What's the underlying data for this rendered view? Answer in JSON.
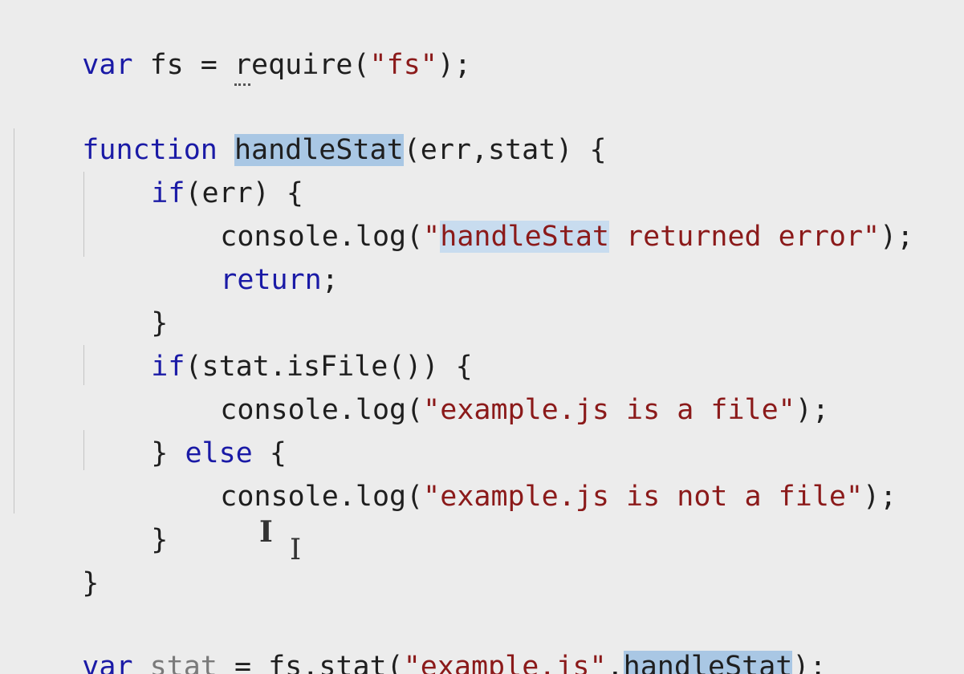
{
  "code": {
    "l1": {
      "kw": "var",
      "a": " fs = ",
      "req": "require",
      "b": "(",
      "s": "\"fs\"",
      "c": ");"
    },
    "l3": {
      "kw": "function",
      "sp": " ",
      "name": "handleStat",
      "rest": "(err,stat) {"
    },
    "l4": {
      "kw": "if",
      "rest": "(err) {"
    },
    "l5": {
      "a": "console.log(",
      "q": "\"",
      "hl": "handleStat",
      "s": " returned error\"",
      "c": ");"
    },
    "l6": {
      "kw": "return",
      "c": ";"
    },
    "l7": {
      "a": "}"
    },
    "l8": {
      "kw": "if",
      "rest": "(stat.isFile()) {"
    },
    "l9": {
      "a": "console.log(",
      "s": "\"example.js is a file\"",
      "c": ");"
    },
    "l10": {
      "a": "} ",
      "kw": "else",
      "rest": " {"
    },
    "l11": {
      "a": "console.log(",
      "s": "\"example.js is not a file\"",
      "c": ");"
    },
    "l12": {
      "a": "}"
    },
    "l13": {
      "a": "}"
    },
    "l15": {
      "kw": "var",
      "sp": " ",
      "dim": "stat",
      "a": " = fs.stat(",
      "s": "\"example.js\"",
      "comma": ",",
      "sel": "handleStat",
      "c": ");"
    }
  },
  "cursor_glyph": "I"
}
